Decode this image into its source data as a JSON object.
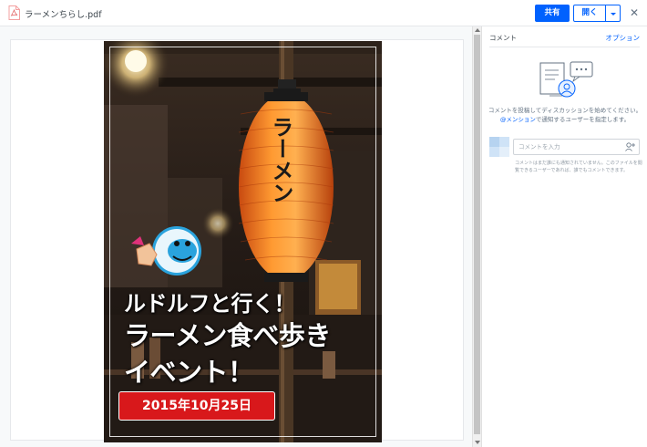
{
  "header": {
    "file_name": "ラーメンちらし.pdf",
    "share_label": "共有",
    "open_label": "開く",
    "close_glyph": "✕"
  },
  "poster": {
    "line1": "ルドルフと行く！",
    "line2": "ラーメン食べ歩き",
    "line3": "イベント！",
    "date": "2015年10月25日",
    "lantern_text": "ラーメン"
  },
  "panel": {
    "title": "コメント",
    "options_label": "オプション",
    "help_line1": "コメントを投稿してディスカッションを始めてください。",
    "help_mention": "@メンション",
    "help_line2_rest": "で通知するユーザーを指定します。",
    "input_placeholder": "コメントを入力",
    "note": "コメントはまだ誰にも通知されていません。このファイルを閲覧できるユーザーであれば、誰でもコメントできます。"
  },
  "colors": {
    "accent": "#0061fe",
    "date_badge": "#d8181b",
    "lantern": "#f07a1c"
  },
  "icons": {
    "file": "pdf-file-icon",
    "close": "close-icon",
    "caret": "chevron-down-icon",
    "illustration": "comment-illustration-icon",
    "mention": "mention-user-icon"
  }
}
